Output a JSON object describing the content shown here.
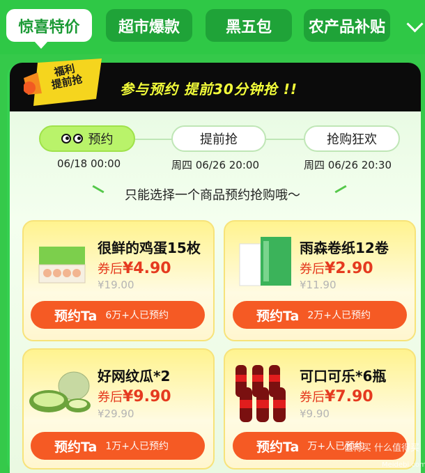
{
  "tabs": [
    {
      "label": "惊喜特价"
    },
    {
      "label": "超市爆款"
    },
    {
      "label": "黑五包"
    },
    {
      "label": "农产品补贴"
    }
  ],
  "banner": {
    "badge": "福利\n提前抢",
    "headline": "参与预约 提前30分钟抢 !!"
  },
  "steps": [
    {
      "label": "预约",
      "time": "06/18 00:00"
    },
    {
      "label": "提前抢",
      "time": "周四 06/26 20:00"
    },
    {
      "label": "抢购狂欢",
      "time": "周四 06/26 20:30"
    }
  ],
  "notice": "只能选择一个商品预约抢购哦～",
  "products": [
    {
      "name": "很鲜的鸡蛋15枚",
      "price_prefix": "券后",
      "price": "¥4.90",
      "original": "¥19.00",
      "button": "预约Ta",
      "reserved": "6万+人已预约"
    },
    {
      "name": "雨森卷纸12卷",
      "price_prefix": "券后",
      "price": "¥2.90",
      "original": "¥11.90",
      "button": "预约Ta",
      "reserved": "2万+人已预约"
    },
    {
      "name": "好网纹瓜*2",
      "price_prefix": "券后",
      "price": "¥9.90",
      "original": "¥29.90",
      "button": "预约Ta",
      "reserved": "1万+人已预约"
    },
    {
      "name": "可口可乐*6瓶",
      "price_prefix": "券后",
      "price": "¥7.90",
      "original": "¥9.90",
      "button": "预约Ta",
      "reserved": "万+人已预约"
    }
  ],
  "watermark": "值得买 什么值得买",
  "watermark_site": "Meidebi.com",
  "colors": {
    "accent": "#2fc846",
    "button": "#f55a24",
    "price": "#e53a1f"
  }
}
